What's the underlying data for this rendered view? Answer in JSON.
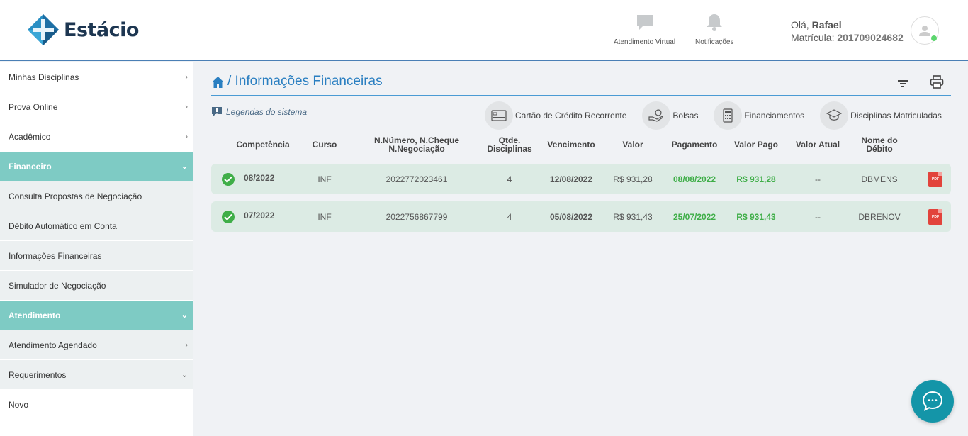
{
  "brand": {
    "name": "Estácio"
  },
  "header": {
    "actions": [
      {
        "label": "Atendimento Virtual",
        "icon": "chat-bubble-icon"
      },
      {
        "label": "Notificações",
        "icon": "bell-icon"
      }
    ],
    "greeting_prefix": "Olá, ",
    "user_name": "Rafael",
    "matricula_label": "Matrícula: ",
    "matricula_value": "201709024682"
  },
  "sidebar": {
    "items": [
      {
        "label": "Minhas Disciplinas",
        "type": "top",
        "chevron": "›"
      },
      {
        "label": "Prova Online",
        "type": "top",
        "chevron": "›"
      },
      {
        "label": "Acadêmico",
        "type": "top",
        "chevron": "›"
      },
      {
        "label": "Financeiro",
        "type": "section",
        "chevron": "⌄"
      },
      {
        "label": "Consulta Propostas de Negociação",
        "type": "sub",
        "chevron": ""
      },
      {
        "label": "Débito Automático em Conta",
        "type": "sub",
        "chevron": ""
      },
      {
        "label": "Informações Financeiras",
        "type": "sub",
        "chevron": ""
      },
      {
        "label": "Simulador de Negociação",
        "type": "sub",
        "chevron": ""
      },
      {
        "label": "Atendimento",
        "type": "section",
        "chevron": "⌄"
      },
      {
        "label": "Atendimento Agendado",
        "type": "sub",
        "chevron": "›"
      },
      {
        "label": "Requerimentos",
        "type": "sub",
        "chevron": "⌄"
      },
      {
        "label": "Novo",
        "type": "top",
        "chevron": ""
      }
    ]
  },
  "page": {
    "title": "/ Informações Financeiras",
    "legend_link": "Legendas do sistema",
    "filters": [
      {
        "label": "Cartão de Crédito Recorrente",
        "icon": "credit-card-icon"
      },
      {
        "label": "Bolsas",
        "icon": "hand-money-icon"
      },
      {
        "label": "Financiamentos",
        "icon": "calculator-icon"
      },
      {
        "label": "Disciplinas Matriculadas",
        "icon": "graduation-cap-icon"
      }
    ]
  },
  "table": {
    "headers": {
      "competencia": "Competência",
      "curso": "Curso",
      "numero_line1": "N.Número, N.Cheque",
      "numero_line2": "N.Negociação",
      "qtde_line1": "Qtde.",
      "qtde_line2": "Disciplinas",
      "vencimento": "Vencimento",
      "valor": "Valor",
      "pagamento": "Pagamento",
      "valor_pago": "Valor Pago",
      "valor_atual": "Valor Atual",
      "nome_line1": "Nome do",
      "nome_line2": "Débito"
    },
    "rows": [
      {
        "competencia": "08/2022",
        "curso": "INF",
        "numero": "2022772023461",
        "qtde": "4",
        "vencimento": "12/08/2022",
        "valor": "R$ 931,28",
        "pagamento": "08/08/2022",
        "valor_pago": "R$ 931,28",
        "valor_atual": "--",
        "nome": "DBMENS",
        "status": "paid"
      },
      {
        "competencia": "07/2022",
        "curso": "INF",
        "numero": "2022756867799",
        "qtde": "4",
        "vencimento": "05/08/2022",
        "valor": "R$ 931,43",
        "pagamento": "25/07/2022",
        "valor_pago": "R$ 931,43",
        "valor_atual": "--",
        "nome": "DBRENOV",
        "status": "paid"
      }
    ],
    "pdf_badge": "PDF"
  },
  "colors": {
    "accent": "#2a7fc1",
    "section": "#7ecbc4",
    "paid_green": "#3fae48",
    "row_bg": "#dcebe4",
    "chat_fab": "#1495a8"
  }
}
